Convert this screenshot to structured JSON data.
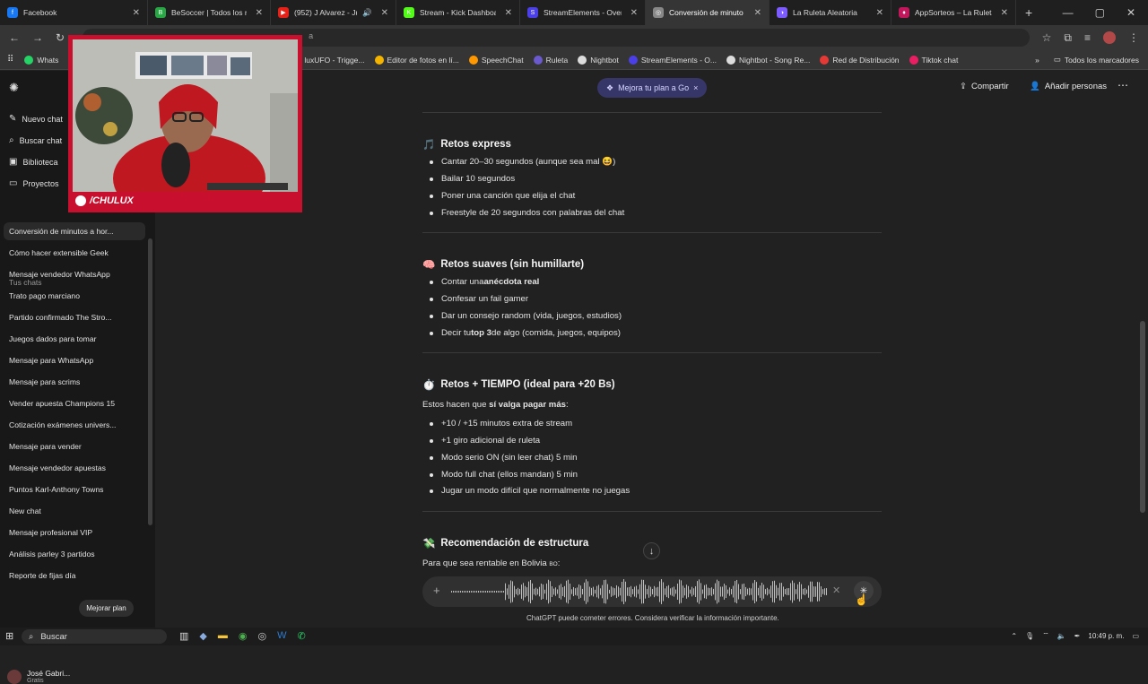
{
  "browser": {
    "tabs": [
      {
        "title": "Facebook",
        "color": "#1877f2",
        "glyph": "f"
      },
      {
        "title": "BeSoccer | Todos los resu",
        "color": "#27a845",
        "glyph": "B"
      },
      {
        "title": "(952) J Alvarez - Junto",
        "color": "#e62117",
        "glyph": "▶",
        "audio": "🔊"
      },
      {
        "title": "Stream - Kick Dashboard",
        "color": "#53fc18",
        "glyph": "K"
      },
      {
        "title": "StreamElements - Overlay",
        "color": "#4b3fe8",
        "glyph": "S"
      },
      {
        "title": "Conversión de minuto",
        "color": "#888888",
        "glyph": "◎",
        "active": true
      },
      {
        "title": "La Ruleta Aleatoria",
        "color": "#7c5cff",
        "glyph": "◑"
      },
      {
        "title": "AppSorteos – La Ruleta d",
        "color": "#c2185b",
        "glyph": "♦"
      }
    ],
    "address_fragment": "a",
    "bookmarks": [
      {
        "label": "Whats",
        "color": "#25d366"
      },
      {
        "label": "luxUFO - Trigge...",
        "color": "#777777"
      },
      {
        "label": "Editor de fotos en lí...",
        "color": "#f4b400"
      },
      {
        "label": "SpeechChat",
        "color": "#ff9800"
      },
      {
        "label": "Ruleta",
        "color": "#6a5acd"
      },
      {
        "label": "Nightbot",
        "color": "#dddddd"
      },
      {
        "label": "StreamElements - O...",
        "color": "#4b3fe8"
      },
      {
        "label": "Nightbot - Song Re...",
        "color": "#dddddd"
      },
      {
        "label": "Red de Distribución",
        "color": "#e53935"
      },
      {
        "label": "Tiktok chat",
        "color": "#e91e63"
      }
    ],
    "all_bookmarks": "Todos los marcadores"
  },
  "sidebar": {
    "nav": [
      {
        "label": "Nuevo chat",
        "icon": "pencil-icon",
        "glyph": "✎"
      },
      {
        "label": "Buscar chat",
        "icon": "search-icon",
        "glyph": "⌕"
      },
      {
        "label": "Biblioteca",
        "icon": "library-icon",
        "glyph": "▣"
      },
      {
        "label": "Proyectos",
        "icon": "folder-icon",
        "glyph": "▭"
      }
    ],
    "chats_label": "Tus chats",
    "chats": [
      "Conversión de minutos a hor...",
      "Cómo hacer extensible Geek",
      "Mensaje vendedor WhatsApp",
      "Trato pago marciano",
      "Partido confirmado The Stro...",
      "Juegos dados para tomar",
      "Mensaje para WhatsApp",
      "Mensaje para scrims",
      "Vender apuesta Champions 15",
      "Cotización exámenes univers...",
      "Mensaje para vender",
      "Mensaje vendedor apuestas",
      "Puntos Karl-Anthony Towns",
      "New chat",
      "Mensaje profesional VIP",
      "Análisis parley 3 partidos",
      "Reporte de fijas día"
    ],
    "user": {
      "name": "José Gabri...",
      "plan": "Gratis",
      "upgrade": "Mejorar plan"
    }
  },
  "header": {
    "promo": "Mejora tu plan a Go",
    "share": "Compartir",
    "add_people": "Añadir personas"
  },
  "content": {
    "sections": [
      {
        "emoji": "🎵",
        "title": "Retos express",
        "items": [
          [
            {
              "t": "Cantar 20–30 segundos (aunque sea mal 😆)"
            }
          ],
          [
            {
              "t": "Bailar 10 segundos"
            }
          ],
          [
            {
              "t": "Poner una canción que elija el chat"
            }
          ],
          [
            {
              "t": "Freestyle de 20 segundos con palabras del chat"
            }
          ]
        ]
      },
      {
        "emoji": "🧠",
        "title": "Retos suaves (sin humillarte)",
        "items": [
          [
            {
              "t": "Contar una "
            },
            {
              "t": "anécdota real",
              "b": true
            }
          ],
          [
            {
              "t": "Confesar un fail gamer"
            }
          ],
          [
            {
              "t": "Dar un consejo random (vida, juegos, estudios)"
            }
          ],
          [
            {
              "t": "Decir tu "
            },
            {
              "t": "top 3",
              "b": true
            },
            {
              "t": " de algo (comida, juegos, equipos)"
            }
          ]
        ]
      },
      {
        "emoji": "⏱️",
        "title": "Retos + TIEMPO (ideal para +20 Bs)",
        "intro": [
          {
            "t": "Estos hacen que "
          },
          {
            "t": "sí valga pagar más",
            "b": true
          },
          {
            "t": ":"
          }
        ],
        "items": [
          [
            {
              "t": "+10 / +15 minutos extra de stream"
            }
          ],
          [
            {
              "t": "+1 giro adicional de ruleta"
            }
          ],
          [
            {
              "t": "Modo serio ON (sin leer chat) 5 min"
            }
          ],
          [
            {
              "t": "Modo full chat (ellos mandan) 5 min"
            }
          ],
          [
            {
              "t": "Jugar un modo difícil que normalmente no juegas"
            }
          ]
        ]
      },
      {
        "emoji": "💸",
        "title": "Recomendación de estructura",
        "intro": [
          {
            "t": "Para que sea rentable en Bolivia "
          },
          {
            "t": "BO",
            "small": true
          },
          {
            "t": ":"
          }
        ]
      }
    ]
  },
  "disclaimer": "ChatGPT puede cometer errores. Considera verificar la información importante.",
  "webcam": {
    "label": "/CHULUX"
  },
  "taskbar": {
    "search": "Buscar",
    "time": "10:49 p. m."
  }
}
